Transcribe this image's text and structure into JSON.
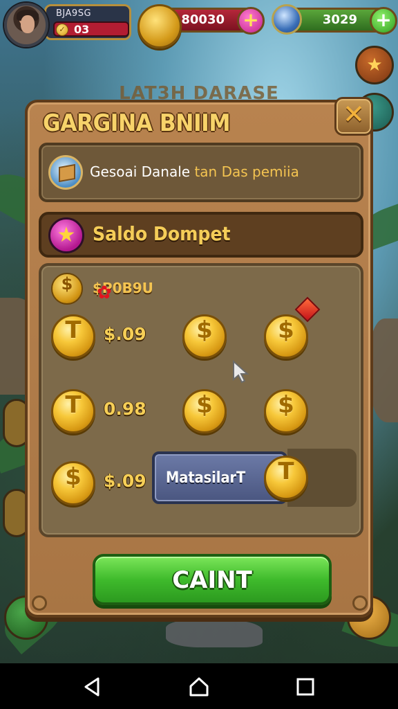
{
  "hud": {
    "player_name": "BJA9SG",
    "level": "03",
    "coins": "80030",
    "gems": "3029"
  },
  "background": {
    "faded_title": "LAT3H DARASE"
  },
  "dialog": {
    "title": "GARGINA BNIIM",
    "info_text_prefix": "Gesoai",
    "info_text_mid": " Danale ",
    "info_text_gold": "tan Das pemiia",
    "wallet_label": "Saldo Dompet",
    "panel_header": "$P0B9U",
    "rows": [
      {
        "coin_symbol": "T",
        "value": "$.09"
      },
      {
        "coin_symbol": "T",
        "value": "0.98"
      },
      {
        "coin_symbol": "$",
        "value": "$.09"
      }
    ],
    "extra_coin_symbol": "$",
    "market_button_label": "MatasilarT",
    "market_coin_symbol": "T",
    "primary_button_label": "CAINT",
    "close_symbol": "✕"
  },
  "colors": {
    "accent_gold": "#f6cf57",
    "primary_green": "#3fbb2c",
    "dialog_brown": "#a87544"
  }
}
